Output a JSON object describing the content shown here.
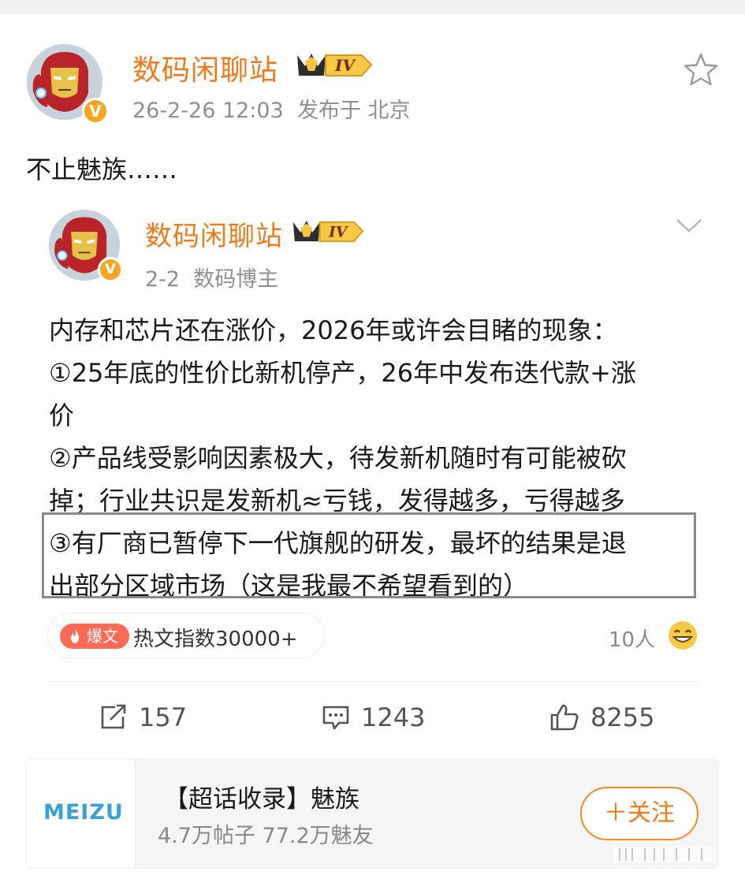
{
  "post": {
    "author": "数码闲聊站",
    "level_badge": "IV",
    "verified_badge": "V",
    "timestamp": "26-2-26 12:03",
    "location": "发布于 北京",
    "text": "不止魅族……"
  },
  "repost": {
    "author": "数码闲聊站",
    "level_badge": "IV",
    "verified_badge": "V",
    "date": "2-2",
    "role": "数码博主",
    "lines": [
      "内存和芯片还在涨价，2026年或许会目睹的现象：",
      "①25年底的性价比新机停产，26年中发布迭代款+涨",
      "价",
      "②产品线受影响因素极大，待发新机随时有可能被砍",
      "掉；行业共识是发新机≈亏钱，发得越多，亏得越多",
      "③有厂商已暂停下一代旗舰的研发，最坏的结果是退",
      "出部分区域市场（这是我最不希望看到的）"
    ],
    "hot_tag": "爆文",
    "hot_index": "热文指数30000+",
    "reaction_count": "10人"
  },
  "actions": {
    "repost_count": "157",
    "comment_count": "1243",
    "like_count": "8255"
  },
  "topic": {
    "logo_text": "MEIZU",
    "title": "【超话收录】魅族",
    "stats": "4.7万帖子 77.2万魅友",
    "follow_label": "＋关注"
  },
  "colors": {
    "accent": "#f0791c",
    "hot_tag": "#ff6a55",
    "meta_text": "#8f8f8f",
    "meizu_logo": "#3aa0d8"
  },
  "icons": [
    "star-icon",
    "chevron-down-icon",
    "fire-icon",
    "grin-emoji-icon",
    "repost-icon",
    "comment-icon",
    "like-icon"
  ]
}
